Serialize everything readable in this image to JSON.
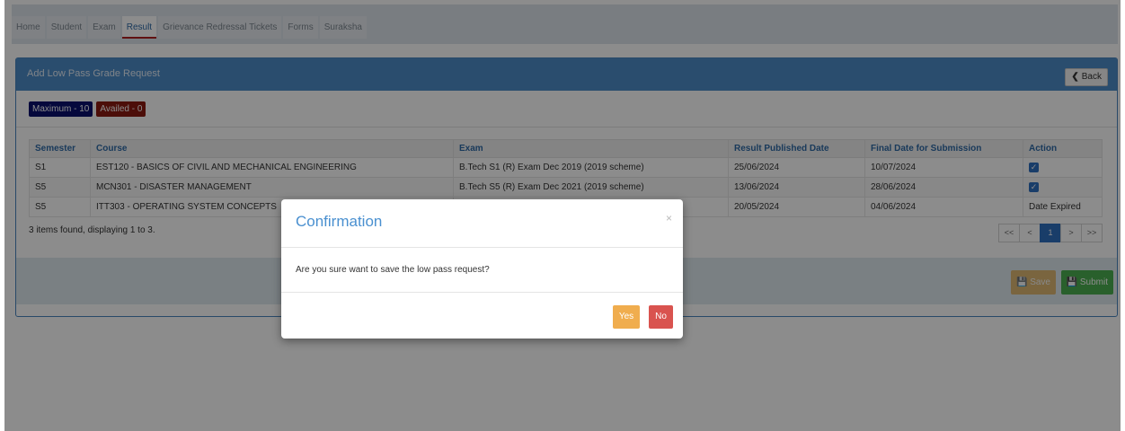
{
  "nav": {
    "tabs": [
      "Home",
      "Student",
      "Exam",
      "Result",
      "Grievance Redressal Tickets",
      "Forms",
      "Suraksha"
    ],
    "active_tab": "Result"
  },
  "panel": {
    "title": "Add Low Pass Grade Request",
    "back_label": "Back",
    "badge_max": "Maximum - 10",
    "badge_availed": "Availed - 0"
  },
  "table": {
    "headers": [
      "Semester",
      "Course",
      "Exam",
      "Result Published Date",
      "Final Date for Submission",
      "Action"
    ],
    "rows": [
      {
        "semester": "S1",
        "course": "EST120 - BASICS OF CIVIL AND MECHANICAL ENGINEERING",
        "exam": "B.Tech S1 (R) Exam Dec 2019 (2019 scheme)",
        "published": "25/06/2024",
        "final": "10/07/2024",
        "action": "checked"
      },
      {
        "semester": "S5",
        "course": "MCN301 - DISASTER MANAGEMENT",
        "exam": "B.Tech S5 (R) Exam Dec 2021 (2019 scheme)",
        "published": "13/06/2024",
        "final": "28/06/2024",
        "action": "checked"
      },
      {
        "semester": "S5",
        "course": "ITT303 - OPERATING SYSTEM CONCEPTS",
        "exam": "",
        "published": "20/05/2024",
        "final": "04/06/2024",
        "action": "Date Expired"
      }
    ]
  },
  "pagination": {
    "summary": "3 items found, displaying 1 to 3.",
    "first": "<<",
    "prev": "<",
    "current": "1",
    "next": ">",
    "last": ">>"
  },
  "actions": {
    "save_label": "Save",
    "submit_label": "Submit"
  },
  "modal": {
    "title": "Confirmation",
    "close": "×",
    "message": "Are you sure want to save the low pass request?",
    "yes_label": "Yes",
    "no_label": "No"
  },
  "colors": {
    "primary": "#4d8cc9",
    "danger": "#d9534f",
    "warning": "#f0ad4e",
    "success": "#4caf50"
  }
}
